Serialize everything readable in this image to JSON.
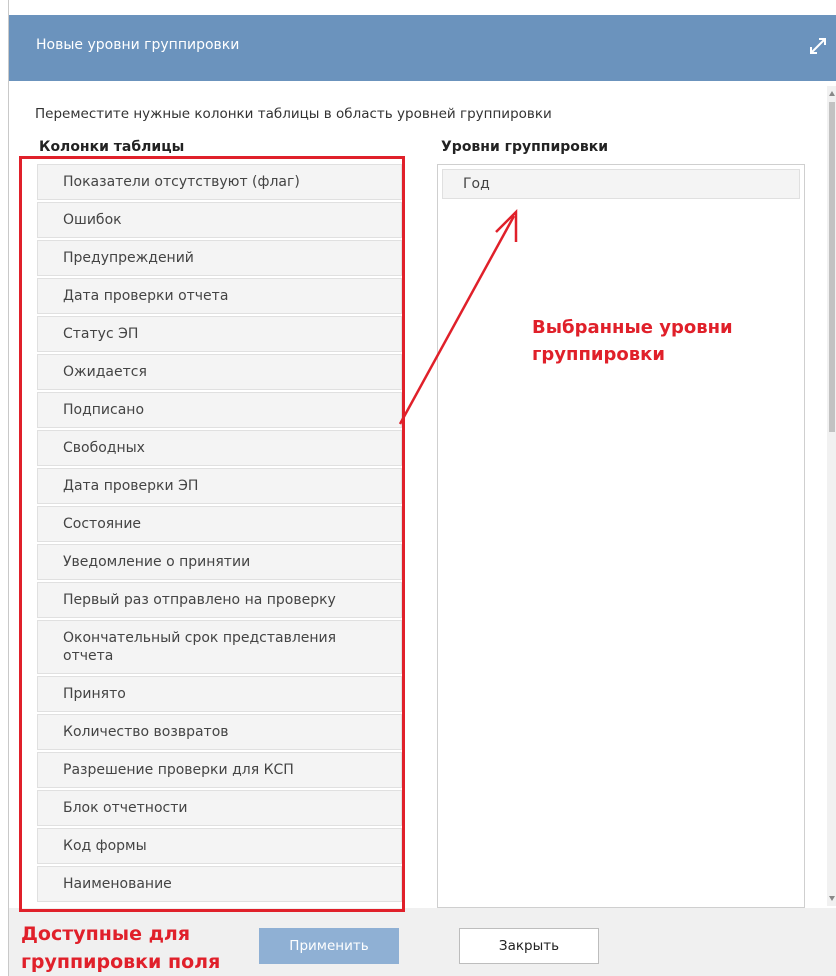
{
  "dialog": {
    "title": "Новые уровни группировки",
    "instruction": "Переместите нужные колонки таблицы в область уровней группировки",
    "left_header": "Колонки таблицы",
    "right_header": "Уровни группировки",
    "title_bar_color": "#6b93bd"
  },
  "table_columns": [
    "Показатели отсутствуют (флаг)",
    "Ошибок",
    "Предупреждений",
    "Дата проверки отчета",
    "Статус ЭП",
    "Ожидается",
    "Подписано",
    "Свободных",
    "Дата проверки ЭП",
    "Состояние",
    "Уведомление о принятии",
    "Первый раз отправлено на проверку",
    "Окончательный срок представления отчета",
    "Принято",
    "Количество возвратов",
    "Разрешение проверки для КСП",
    "Блок отчетности",
    "Код формы",
    "Наименование"
  ],
  "grouping_levels": [
    "Год"
  ],
  "buttons": {
    "apply": "Применить",
    "close": "Закрыть"
  },
  "annotations": {
    "selected_levels_line1": "Выбранные уровни",
    "selected_levels_line2": "группировки",
    "available_fields_line1": "Доступные для",
    "available_fields_line2": "группировки поля",
    "color": "#e0202a"
  },
  "icons": {
    "expand": "expand-diagonal-icon"
  }
}
